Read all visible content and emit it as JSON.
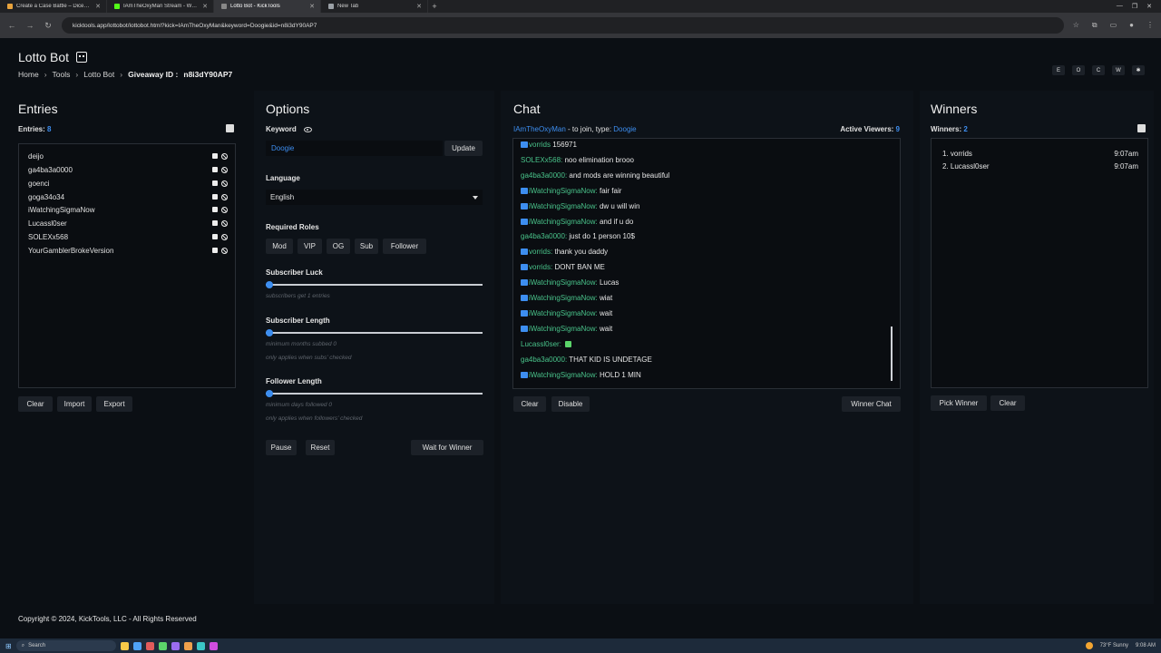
{
  "browser": {
    "tabs": [
      {
        "title": "Create a Case Battle – Dicebloc",
        "color": "#e8a33d"
      },
      {
        "title": "IAmTheOxyMan Stream - Watch",
        "color": "#53fc18"
      },
      {
        "title": "Lotto Bot - KickTools",
        "color": "#888888",
        "active": true
      },
      {
        "title": "New Tab",
        "color": "#9aa0a6"
      }
    ],
    "url": "kicktools.app/lottobot/lottobot.html?kick=IAmTheOxyMan&keyword=Doogie&id=n8i3dY90AP7"
  },
  "header": {
    "title": "Lotto Bot",
    "breadcrumb": [
      "Home",
      "Tools",
      "Lotto Bot"
    ],
    "giveaway_label": "Giveaway ID :",
    "giveaway_id": "n8i3dY90AP7",
    "theme_buttons": [
      "E",
      "O",
      "C",
      "W",
      "✱"
    ]
  },
  "entries": {
    "title": "Entries",
    "count_label": "Entries:",
    "count": "8",
    "items": [
      "deijo",
      "ga4ba3a0000",
      "goenci",
      "goga34o34",
      "iWatchingSigmaNow",
      "Lucassl0ser",
      "SOLEXx568",
      "YourGamblerBrokeVersion"
    ],
    "buttons": {
      "clear": "Clear",
      "import": "Import",
      "export": "Export"
    }
  },
  "options": {
    "title": "Options",
    "keyword_label": "Keyword",
    "keyword_value": "Doogie",
    "update": "Update",
    "language_label": "Language",
    "language_value": "English",
    "roles_label": "Required Roles",
    "roles": [
      "Mod",
      "VIP",
      "OG",
      "Sub",
      "Follower"
    ],
    "sub_luck_label": "Subscriber Luck",
    "sub_luck_hint": "subscribers get 1 entries",
    "sub_length_label": "Subscriber Length",
    "sub_length_hint1": "minimum months subbed 0",
    "sub_length_hint2": "only applies when subs' checked",
    "follower_length_label": "Follower Length",
    "follower_length_hint1": "minimum days followed 0",
    "follower_length_hint2": "only applies when followers' checked",
    "pause": "Pause",
    "reset": "Reset",
    "wait": "Wait for Winner"
  },
  "chat": {
    "title": "Chat",
    "channel": "IAmTheOxyMan",
    "join_text": " - to join, type: ",
    "keyword": "Doogie",
    "viewers_label": "Active Viewers:",
    "viewers": "9",
    "messages": [
      {
        "user": "vorrids",
        "text": "156971",
        "badge": true
      },
      {
        "user": "SOLEXx568:",
        "text": "noo elimination brooo",
        "badge": false
      },
      {
        "user": "ga4ba3a0000:",
        "text": "and mods are winning beautiful",
        "badge": false
      },
      {
        "user": "iWatchingSigmaNow:",
        "text": "fair fair",
        "badge": true
      },
      {
        "user": "iWatchingSigmaNow:",
        "text": "dw u will win",
        "badge": true
      },
      {
        "user": "iWatchingSigmaNow:",
        "text": "and if u do",
        "badge": true
      },
      {
        "user": "ga4ba3a0000:",
        "text": "just do 1 person 10$",
        "badge": false
      },
      {
        "user": "vorrids:",
        "text": "thank you daddy",
        "badge": true
      },
      {
        "user": "vorrids:",
        "text": "DONT BAN ME",
        "badge": true
      },
      {
        "user": "iWatchingSigmaNow:",
        "text": "Lucas",
        "badge": true
      },
      {
        "user": "iWatchingSigmaNow:",
        "text": "wiat",
        "badge": true
      },
      {
        "user": "iWatchingSigmaNow:",
        "text": "wait",
        "badge": true
      },
      {
        "user": "iWatchingSigmaNow:",
        "text": "wait",
        "badge": true
      },
      {
        "user": "Lucassl0ser:",
        "text": "",
        "badge": false,
        "emote": true
      },
      {
        "user": "ga4ba3a0000:",
        "text": "THAT KID IS UNDETAGE",
        "badge": false
      },
      {
        "user": "iWatchingSigmaNow:",
        "text": "HOLD 1 MIN",
        "badge": true
      }
    ],
    "buttons": {
      "clear": "Clear",
      "disable": "Disable",
      "winner_chat": "Winner Chat"
    }
  },
  "winners": {
    "title": "Winners",
    "count_label": "Winners:",
    "count": "2",
    "items": [
      {
        "rank": "1.",
        "name": "vorrids",
        "time": "9:07am"
      },
      {
        "rank": "2.",
        "name": "Lucassl0ser",
        "time": "9:07am"
      }
    ],
    "buttons": {
      "pick": "Pick Winner",
      "clear": "Clear"
    }
  },
  "footer": "Copyright © 2024, KickTools, LLC - All Rights Reserved",
  "taskbar": {
    "search": "Search",
    "weather": "73°F Sunny",
    "time": "9:08 AM"
  }
}
